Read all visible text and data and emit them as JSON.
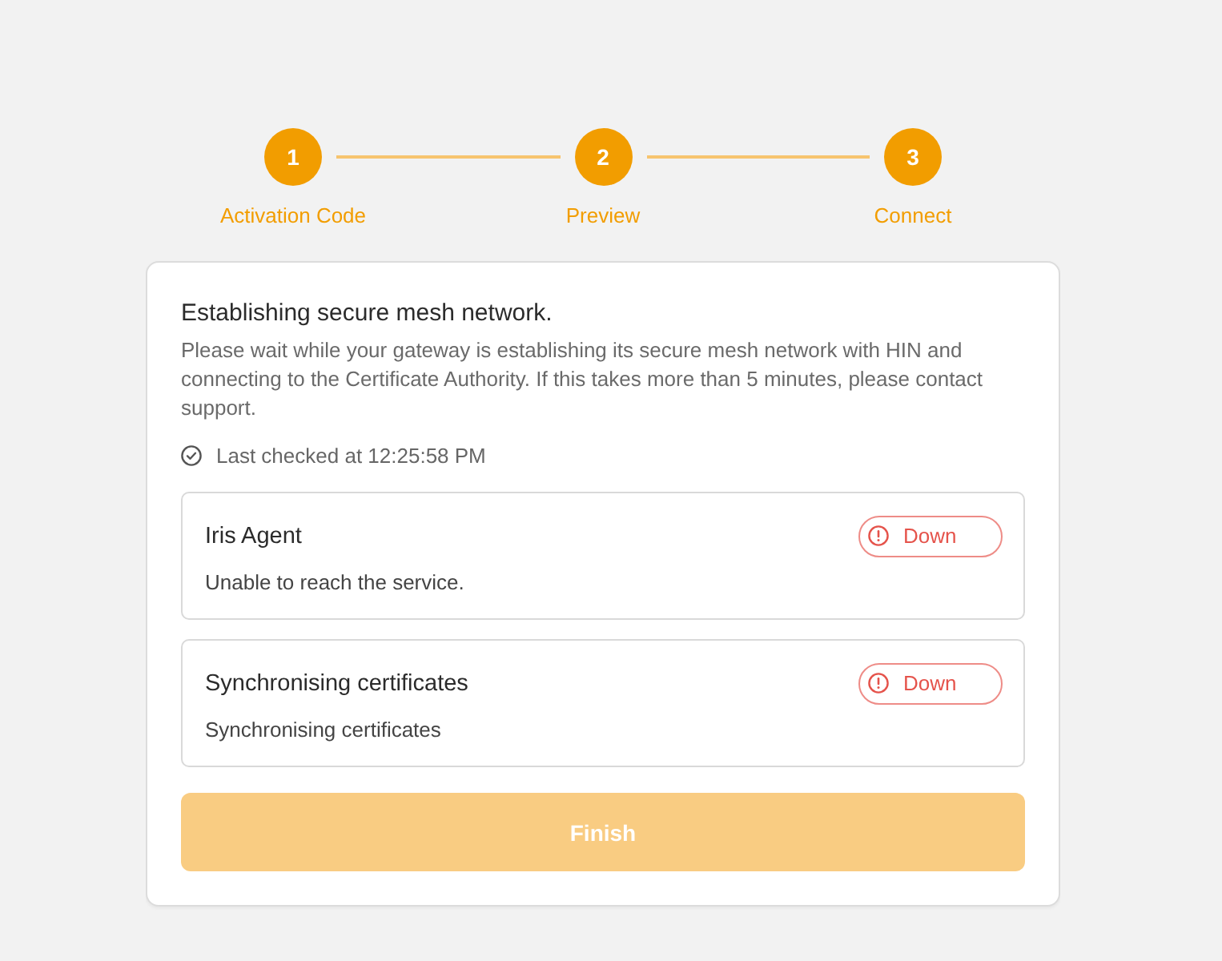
{
  "stepper": {
    "steps": [
      {
        "number": "1",
        "label": "Activation Code",
        "completed": true
      },
      {
        "number": "2",
        "label": "Preview",
        "completed": true
      },
      {
        "number": "3",
        "label": "Connect",
        "completed": true
      }
    ]
  },
  "status_card": {
    "title": "Establishing secure mesh network.",
    "description": "Please wait while your gateway is establishing its secure mesh network with HIN and connecting to the Certificate Authority. If this takes more than 5 minutes, please contact support.",
    "last_checked": "Last checked at 12:25:58 PM",
    "services": [
      {
        "name": "Iris Agent",
        "message": "Unable to reach the service.",
        "status": {
          "label": "Down",
          "color": "#e5534b"
        }
      },
      {
        "name": "Synchronising certificates",
        "message": "Synchronising certificates",
        "status": {
          "label": "Down",
          "color": "#e5534b"
        }
      }
    ],
    "finish_button": {
      "label": "Finish",
      "disabled": true
    }
  }
}
